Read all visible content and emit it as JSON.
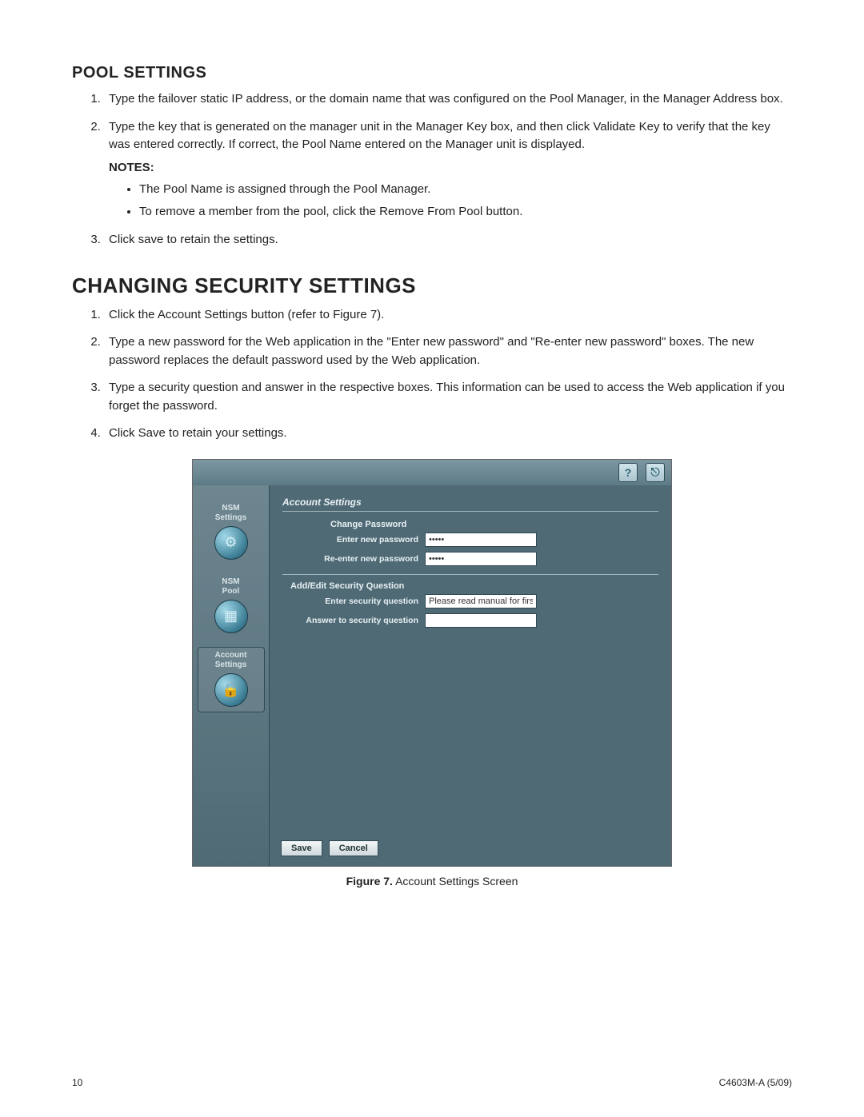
{
  "pool_settings": {
    "heading": "POOL SETTINGS",
    "steps": [
      "Type the failover static IP address, or the domain name that was configured on the Pool Manager, in the Manager Address box.",
      "Type the key that is generated on the manager unit in the Manager Key box, and then click Validate Key to verify that the key was entered correctly. If correct, the Pool Name entered on the Manager unit is displayed.",
      "Click save to retain the settings."
    ],
    "notes_label": "NOTES:",
    "notes": [
      "The Pool Name is assigned through the Pool Manager.",
      "To remove a member from the pool, click the Remove From Pool button."
    ]
  },
  "changing_security": {
    "heading": "CHANGING SECURITY SETTINGS",
    "steps": [
      "Click the Account Settings button (refer to Figure 7).",
      "Type a new password for the Web application in the \"Enter new password\" and \"Re-enter new password\" boxes. The new password replaces the default password used by the Web application.",
      "Type a security question and answer in the respective boxes. This information can be used to access the Web application if you forget the password.",
      "Click Save to retain your settings."
    ]
  },
  "screenshot": {
    "topbar": {
      "help_icon": "?",
      "exit_icon": "⎋"
    },
    "sidebar": {
      "items": [
        {
          "label": "NSM\nSettings",
          "glyph": "⚙"
        },
        {
          "label": "NSM\nPool",
          "glyph": "▦"
        },
        {
          "label": "Account\nSettings",
          "glyph": "🔒"
        }
      ]
    },
    "panel_title": "Account Settings",
    "change_password": {
      "section": "Change Password",
      "enter_label": "Enter new password",
      "enter_value": "•••••",
      "reenter_label": "Re-enter new password",
      "reenter_value": "•••••"
    },
    "security_question": {
      "section": "Add/Edit Security Question",
      "question_label": "Enter security question",
      "question_value": "Please read manual for first time pa",
      "answer_label": "Answer to security question",
      "answer_value": ""
    },
    "buttons": {
      "save": "Save",
      "cancel": "Cancel"
    }
  },
  "figure": {
    "label": "Figure 7.",
    "caption": "Account Settings Screen"
  },
  "footer": {
    "page_number": "10",
    "doc_id": "C4603M-A  (5/09)"
  }
}
